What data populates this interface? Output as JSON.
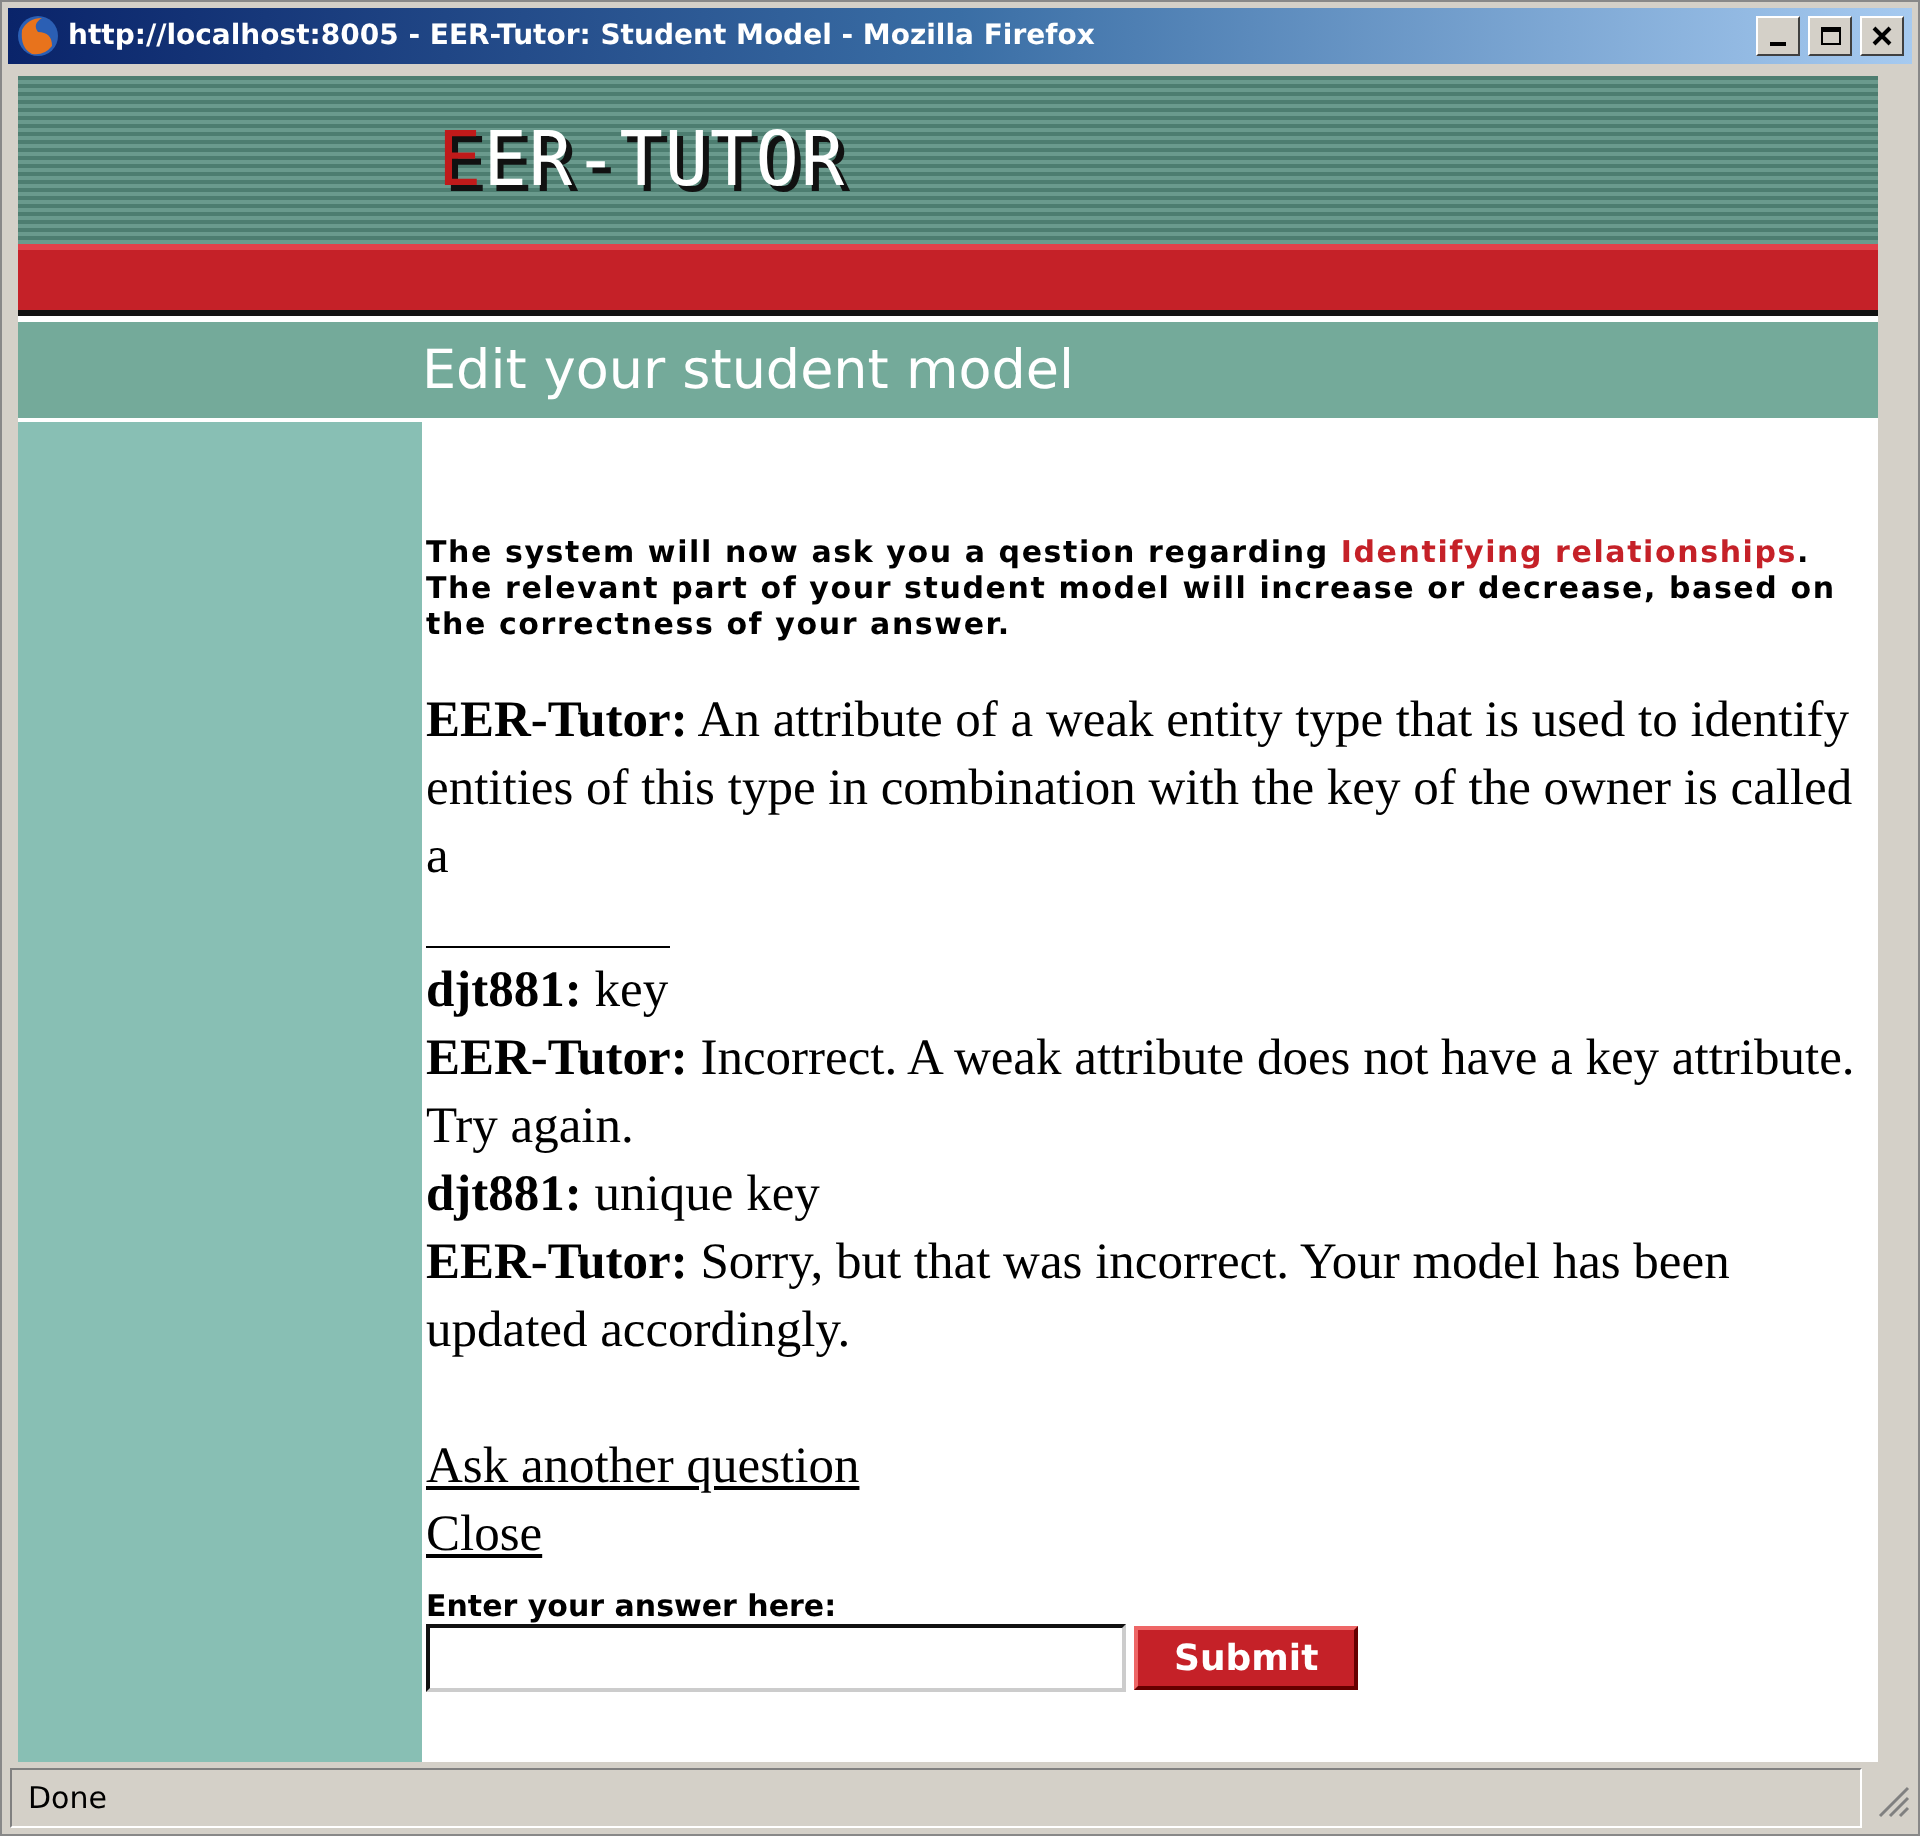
{
  "window": {
    "title": "http://localhost:8005 - EER-Tutor: Student Model - Mozilla Firefox"
  },
  "header": {
    "logo_initial": "E",
    "logo_rest": "ER-TUTOR",
    "page_title": "Edit your student model"
  },
  "intro": {
    "before": "The system will now ask you a qestion regarding ",
    "topic": "Identifying relationships",
    "after": ". The relevant part of your student model will increase or decrease, based on the correctness of your answer."
  },
  "dialogue": [
    {
      "kind": "turn",
      "speaker": "EER-Tutor:",
      "text": "An attribute of a weak entity type that is used to identify entities of this type in combination with the key of the owner is called a"
    },
    {
      "kind": "blank"
    },
    {
      "kind": "turn",
      "speaker": "djt881:",
      "text": "key"
    },
    {
      "kind": "turn",
      "speaker": "EER-Tutor:",
      "text": "Incorrect. A weak attribute does not have a key attribute. Try again."
    },
    {
      "kind": "turn",
      "speaker": "djt881:",
      "text": "unique key"
    },
    {
      "kind": "turn",
      "speaker": "EER-Tutor:",
      "text": "Sorry, but that was incorrect. Your model has been updated accordingly."
    }
  ],
  "links": [
    "Ask another question",
    "Close"
  ],
  "answer": {
    "label": "Enter your answer here:",
    "button": "Submit"
  },
  "status_bar": "Done"
}
